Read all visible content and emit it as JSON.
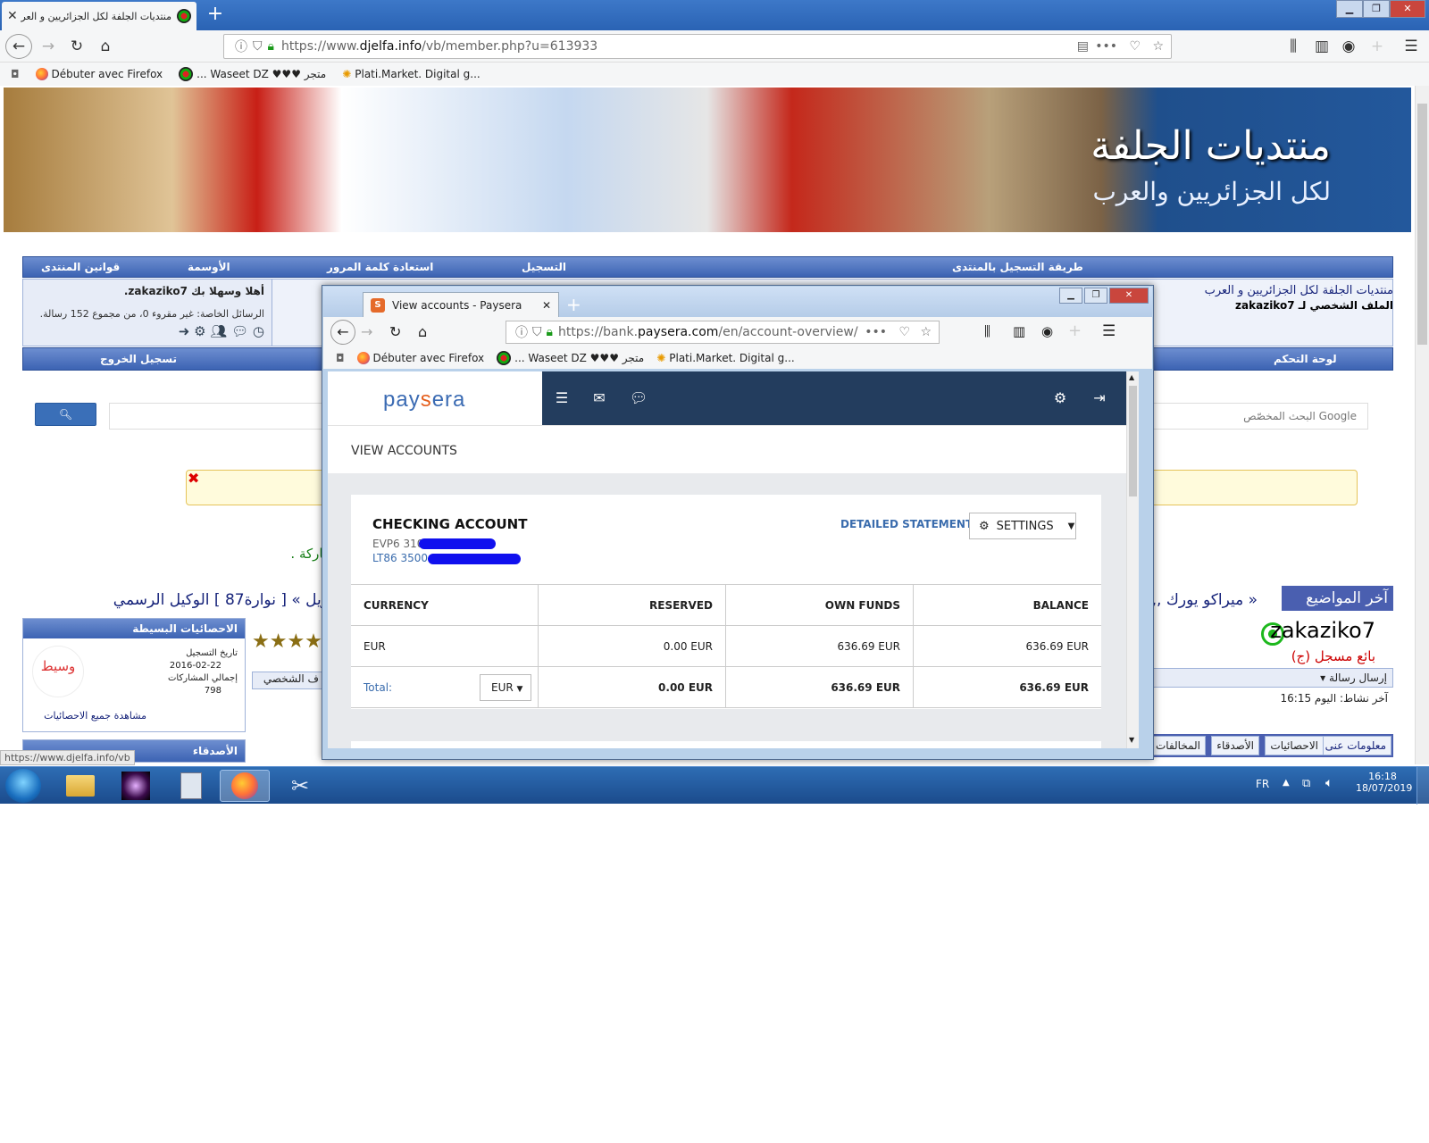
{
  "outer_browser": {
    "tab_title": "منتديات الجلفة لكل الجزائريين و العر",
    "url_prefix": "https://www.",
    "url_domain": "djelfa.info",
    "url_suffix": "/vb/member.php?u=613933",
    "bookmarks": [
      "Débuter avec Firefox",
      "... Waseet DZ ♥♥♥ متجر",
      "Plati.Market. Digital g..."
    ],
    "status_url": "https://www.djelfa.info/vb"
  },
  "forum": {
    "banner_title": "منتديات الجلفة",
    "banner_sub": "لكل الجزائريين والعرب",
    "top_nav": [
      "طريقة التسجيل بالمنتدى",
      "التسجيل",
      "استعادة كلمة المرور",
      "الأوسمة",
      "قوانين المنتدى"
    ],
    "welcome": "أهلا وسهلا بك zakaziko7.",
    "pm_text": "الرسائل الخاصة: غير مقروء 0، من مجموع 152 رسالة.",
    "crumb_site": "منتديات الجلفة لكل الجزائريين و العرب",
    "crumb_profile": "الملف الشخصي لـ zakaziko7",
    "control_panel": "لوحة التحكم",
    "logout": "تسجيل الخروج",
    "search_placeholder": "Google البحث المخصّص",
    "green_text": "ماركة .",
    "latest_label": "آخر المواضيع",
    "latest_ticker": "ويل » [ نوارة87 ]   الوكيل الرسمي",
    "latest_right": "02,, ميراكو يورك »",
    "stats_title": "الاحصائيات البسيطة",
    "reg_date_label": "تاريخ التسجيل",
    "reg_date": "2016-02-22",
    "posts_label": "إجمالي المشاركات",
    "posts": "798",
    "see_all_stats": "مشاهدة جميع الاحصائيات",
    "friends_title": "الأصدقاء",
    "avatar_text": "وسيط",
    "username": "zakaziko7",
    "user_title": "بائع مسجل (ج)",
    "send_message": "إرسال رسالة",
    "last_activity": "آخر نشاط: اليوم 16:15",
    "profile_tab_left": "ف الشخصي",
    "profile_tabs": [
      "معلومات عنى",
      "الاحصائيات",
      "الأصدقاء",
      "المخالفات"
    ]
  },
  "inner_browser": {
    "tab_title": "View accounts - Paysera",
    "url_prefix": "https://bank.",
    "url_domain": "paysera.com",
    "url_suffix": "/en/account-overview/",
    "bookmarks": [
      "Débuter avec Firefox",
      "... Waseet DZ ♥♥♥ متجر",
      "Plati.Market. Digital g..."
    ]
  },
  "paysera": {
    "logo_a": "pay",
    "logo_b": "s",
    "logo_c": "era",
    "page_title": "VIEW ACCOUNTS",
    "account_name": "CHECKING ACCOUNT",
    "iban_1": "EVP6 310",
    "iban_2": "LT86 3500",
    "detailed_statement": "DETAILED STATEMENT",
    "settings": "SETTINGS",
    "columns": [
      "CURRENCY",
      "RESERVED",
      "OWN FUNDS",
      "BALANCE"
    ],
    "row": {
      "currency": "EUR",
      "reserved": "0.00 EUR",
      "own_funds": "636.69 EUR",
      "balance": "636.69 EUR"
    },
    "total_label": "Total:",
    "total_currency": "EUR",
    "total": {
      "reserved": "0.00 EUR",
      "own_funds": "636.69 EUR",
      "balance": "636.69 EUR"
    }
  },
  "taskbar": {
    "lang": "FR",
    "time": "16:18",
    "date": "18/07/2019"
  }
}
